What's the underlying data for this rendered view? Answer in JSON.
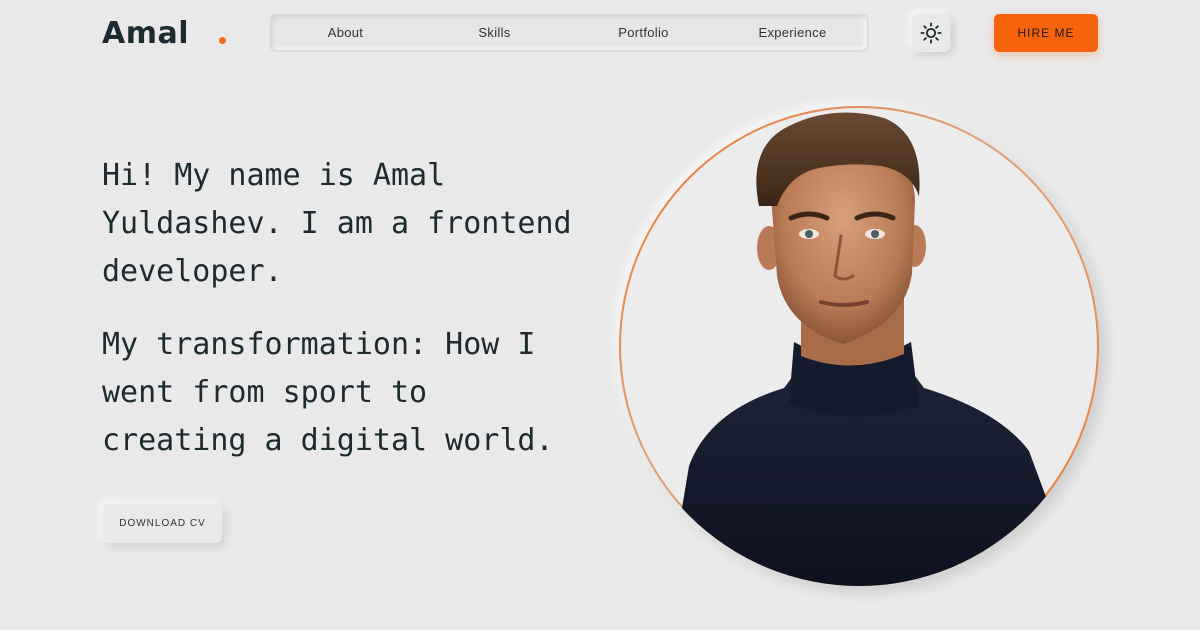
{
  "logo": {
    "text": "Amal",
    "accent_color": "#f26a1b"
  },
  "nav": {
    "items": [
      {
        "label": "About"
      },
      {
        "label": "Skills"
      },
      {
        "label": "Portfolio"
      },
      {
        "label": "Experience"
      }
    ]
  },
  "header": {
    "theme_toggle_icon": "sun-icon",
    "hire_label": "HIRE ME",
    "hire_color": "#f7630c"
  },
  "hero": {
    "intro": "Hi! My name is Amal Yuldashev. I am a frontend developer.",
    "tagline": "My transformation: How I went from sport to creating a digital world.",
    "download_label": "DOWNLOAD CV"
  },
  "portrait": {
    "ring_color": "#f07a2a"
  }
}
